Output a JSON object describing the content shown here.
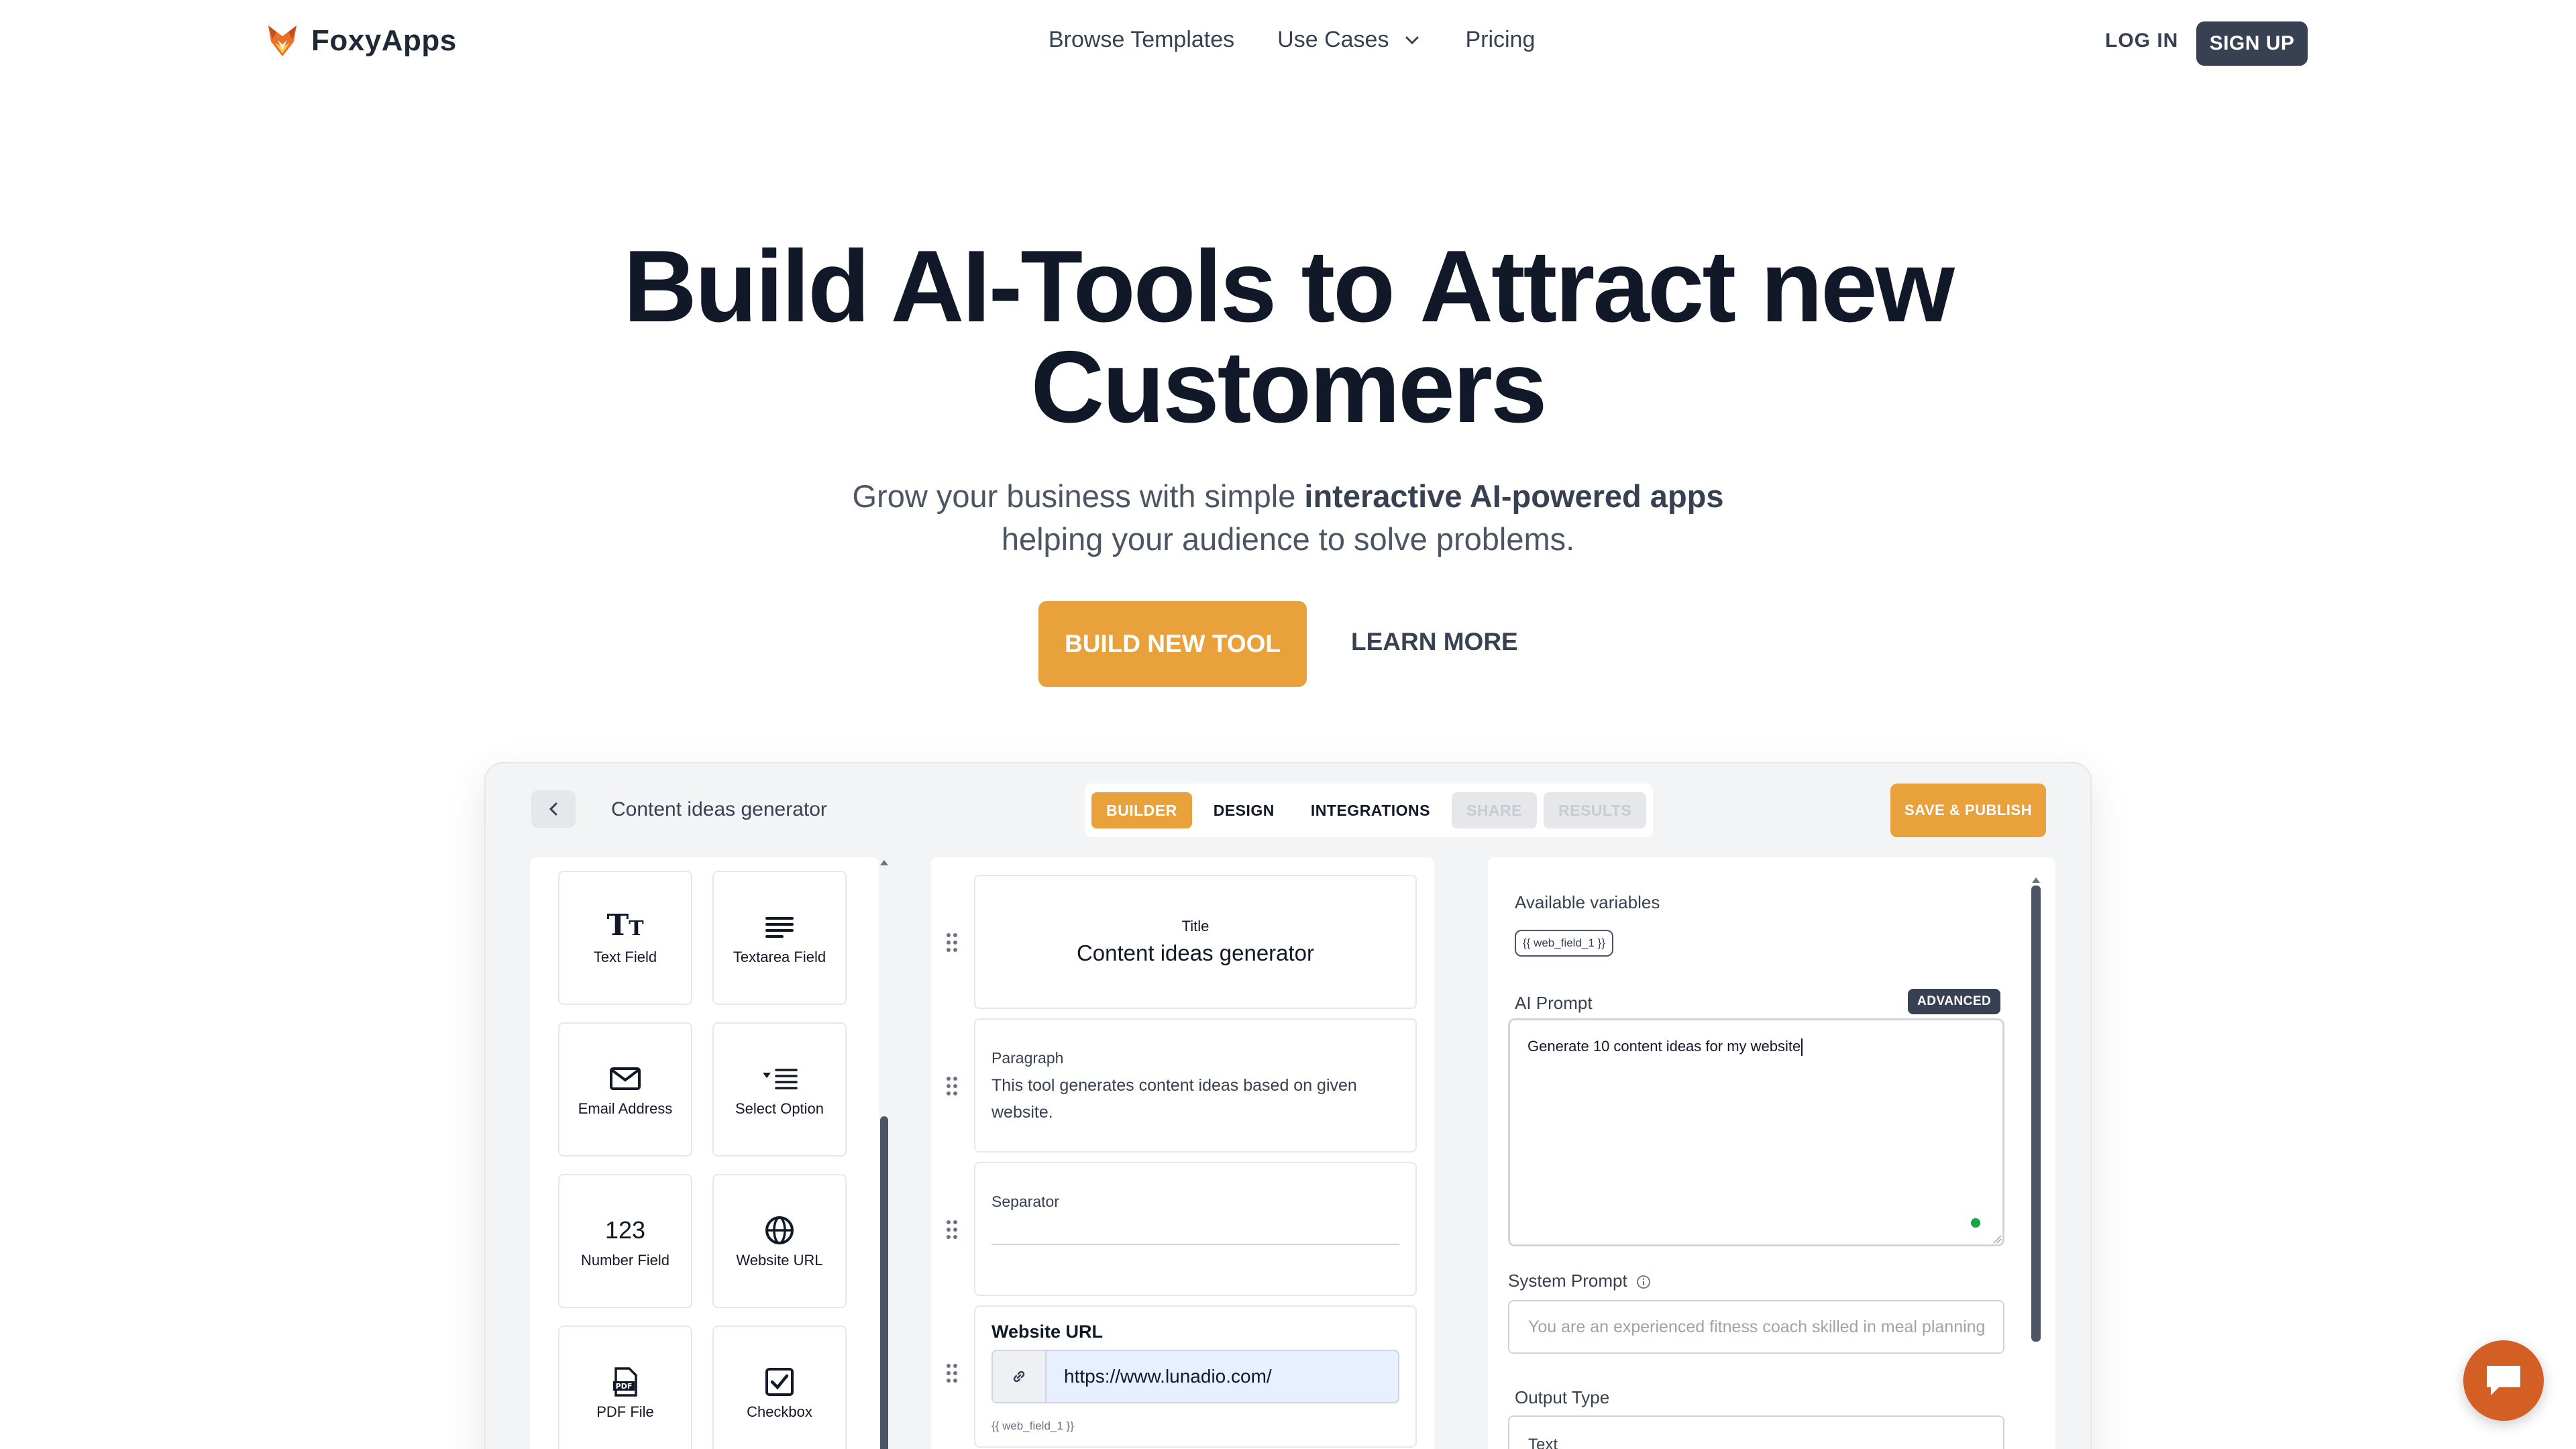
{
  "brand": {
    "name": "FoxyApps",
    "icon": "fox-logo-icon",
    "accent": "#e9a23b",
    "dark": "#374151"
  },
  "nav": {
    "links": [
      "Browse Templates",
      "Use Cases",
      "Pricing"
    ],
    "login": "LOG IN",
    "signup": "SIGN UP"
  },
  "hero": {
    "line1_plain": "Build AI-Tools to ",
    "line1_highlight": "Attract new",
    "line2_highlight": "Customers",
    "sub_line1_plain": "Grow your business with simple ",
    "sub_line1_bold": "interactive AI-powered apps",
    "sub_line2": "helping your audience to solve problems.",
    "primary_cta": "BUILD NEW TOOL",
    "secondary_cta": "LEARN MORE"
  },
  "builder": {
    "title": "Content ideas generator",
    "tabs": [
      "BUILDER",
      "DESIGN",
      "INTEGRATIONS",
      "SHARE",
      "RESULTS"
    ],
    "save": "SAVE & PUBLISH",
    "fields": [
      {
        "label": "Text Field",
        "icon": "text-field-icon"
      },
      {
        "label": "Textarea Field",
        "icon": "textarea-icon"
      },
      {
        "label": "Email Address",
        "icon": "email-icon"
      },
      {
        "label": "Select Option",
        "icon": "select-icon"
      },
      {
        "label": "Number Field",
        "icon": "number-icon",
        "glyph": "123"
      },
      {
        "label": "Website URL",
        "icon": "globe-icon"
      },
      {
        "label": "PDF File",
        "icon": "pdf-icon"
      },
      {
        "label": "Checkbox",
        "icon": "checkbox-icon"
      }
    ],
    "blocks": {
      "title_label": "Title",
      "title_value": "Content ideas generator",
      "paragraph_label": "Paragraph",
      "paragraph_value": "This tool generates content ideas based on given website.",
      "separator_label": "Separator",
      "url_label": "Website URL",
      "url_value": "https://www.lunadio.com/",
      "url_var": "{{ web_field_1 }}"
    },
    "settings": {
      "vars_label": "Available variables",
      "var_chip": "{{ web_field_1 }}",
      "prompt_label": "AI Prompt",
      "advanced": "ADVANCED",
      "prompt_value": "Generate 10 content ideas for my website",
      "system_label": "System Prompt",
      "system_placeholder": "You are an experienced fitness coach skilled in meal planning",
      "output_label": "Output Type",
      "output_value": "Text"
    }
  }
}
